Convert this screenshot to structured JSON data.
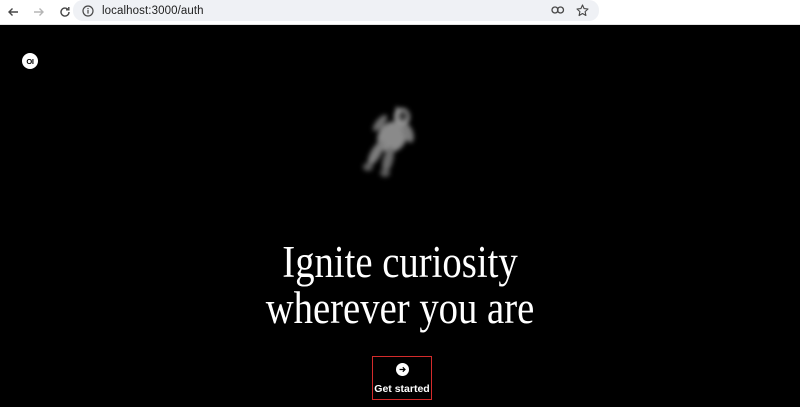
{
  "browser": {
    "url": "localhost:3000/auth",
    "icons": {
      "back": "arrow-left-icon",
      "forward": "arrow-right-icon",
      "reload": "reload-icon",
      "site_info": "site-info-icon",
      "passwords": "key-icon",
      "bookmark": "star-icon"
    }
  },
  "page": {
    "logo_text": "OI",
    "hero_image": "astronaut-illustration",
    "headline_line1": "Ignite curiosity",
    "headline_line2": "wherever you are",
    "cta_label": "Get started",
    "cta_icon": "arrow-right-circle-icon",
    "colors": {
      "background": "#000000",
      "text": "#ffffff",
      "highlight_border": "#d42b2b"
    }
  }
}
